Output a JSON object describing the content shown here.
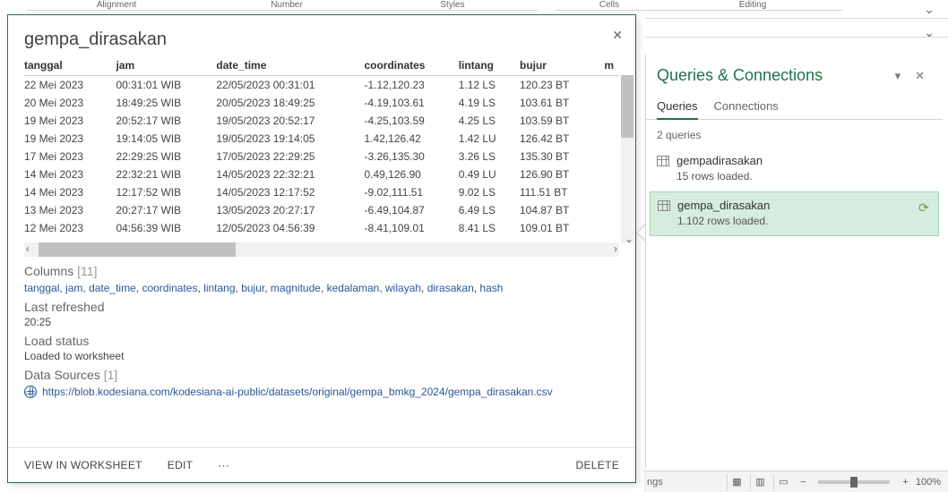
{
  "ribbon": {
    "groups": [
      "Alignment",
      "Number",
      "Styles",
      "Cells",
      "Editing"
    ]
  },
  "popup": {
    "title": "gempa_dirasakan",
    "columns_label": "Columns",
    "columns_count": "[11]",
    "columns": [
      "tanggal",
      "jam",
      "date_time",
      "coordinates",
      "lintang",
      "bujur",
      "magnitude",
      "kedalaman",
      "wilayah",
      "dirasakan",
      "hash"
    ],
    "last_refreshed_label": "Last refreshed",
    "last_refreshed_value": "20:25",
    "load_status_label": "Load status",
    "load_status_value": "Loaded to worksheet",
    "data_sources_label": "Data Sources",
    "data_sources_count": "[1]",
    "data_source_url": "https://blob.kodesiana.com/kodesiana-ai-public/datasets/original/gempa_bmkg_2024/gempa_dirasakan.csv",
    "headers": [
      "tanggal",
      "jam",
      "date_time",
      "coordinates",
      "lintang",
      "bujur",
      "m"
    ],
    "rows": [
      {
        "tanggal": "22 Mei 2023",
        "jam": "00:31:01 WIB",
        "date_time": "22/05/2023 00:31:01",
        "coordinates": "-1.12,120.23",
        "lintang": "1.12 LS",
        "bujur": "120.23 BT"
      },
      {
        "tanggal": "20 Mei 2023",
        "jam": "18:49:25 WIB",
        "date_time": "20/05/2023 18:49:25",
        "coordinates": "-4.19,103.61",
        "lintang": "4.19 LS",
        "bujur": "103.61 BT"
      },
      {
        "tanggal": "19 Mei 2023",
        "jam": "20:52:17 WIB",
        "date_time": "19/05/2023 20:52:17",
        "coordinates": "-4.25,103.59",
        "lintang": "4.25 LS",
        "bujur": "103.59 BT"
      },
      {
        "tanggal": "19 Mei 2023",
        "jam": "19:14:05 WIB",
        "date_time": "19/05/2023 19:14:05",
        "coordinates": "1.42,126.42",
        "lintang": "1.42 LU",
        "bujur": "126.42 BT"
      },
      {
        "tanggal": "17 Mei 2023",
        "jam": "22:29:25 WIB",
        "date_time": "17/05/2023 22:29:25",
        "coordinates": "-3.26,135.30",
        "lintang": "3.26 LS",
        "bujur": "135.30 BT"
      },
      {
        "tanggal": "14 Mei 2023",
        "jam": "22:32:21 WIB",
        "date_time": "14/05/2023 22:32:21",
        "coordinates": "0.49,126.90",
        "lintang": "0.49 LU",
        "bujur": "126.90 BT"
      },
      {
        "tanggal": "14 Mei 2023",
        "jam": "12:17:52 WIB",
        "date_time": "14/05/2023 12:17:52",
        "coordinates": "-9.02,111.51",
        "lintang": "9.02 LS",
        "bujur": "111.51 BT"
      },
      {
        "tanggal": "13 Mei 2023",
        "jam": "20:27:17 WIB",
        "date_time": "13/05/2023 20:27:17",
        "coordinates": "-6.49,104.87",
        "lintang": "6.49 LS",
        "bujur": "104.87 BT"
      },
      {
        "tanggal": "12 Mei 2023",
        "jam": "04:56:39 WIB",
        "date_time": "12/05/2023 04:56:39",
        "coordinates": "-8.41,109.01",
        "lintang": "8.41 LS",
        "bujur": "109.01 BT"
      }
    ],
    "footer": {
      "view": "VIEW IN WORKSHEET",
      "edit": "EDIT",
      "more": "···",
      "delete": "DELETE"
    }
  },
  "qc": {
    "title": "Queries & Connections",
    "tab_queries": "Queries",
    "tab_connections": "Connections",
    "count_label": "2 queries",
    "items": [
      {
        "name": "gempadirasakan",
        "status": "15 rows loaded."
      },
      {
        "name": "gempa_dirasakan",
        "status": "1.102 rows loaded."
      }
    ]
  },
  "statusbar": {
    "left": "ngs",
    "zoom": "100%"
  }
}
